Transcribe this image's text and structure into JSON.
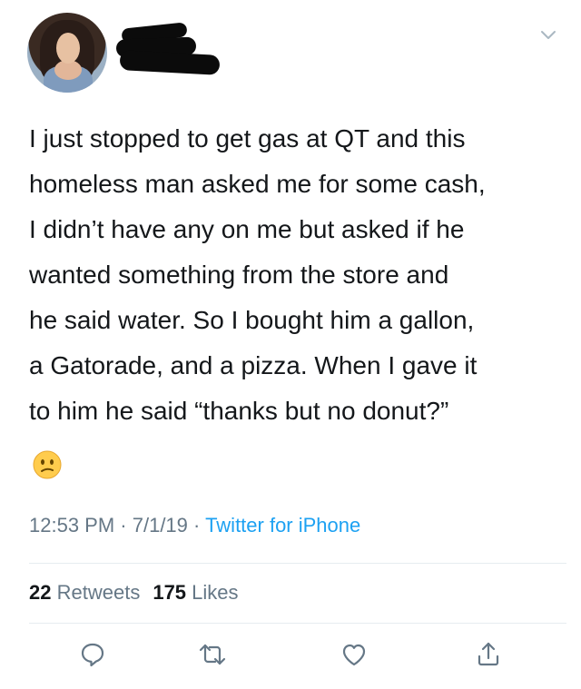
{
  "tweet": {
    "text": "I just stopped to get gas at QT and this\nhomeless man asked me for some cash,\nI didn’t have any on me but asked if he\nwanted something from the store and\nhe said water. So I bought him a gallon,\na Gatorade, and a pizza. When I gave it\nto him he said “thanks but no donut?”",
    "emoji": "confused-face",
    "time": "12:53 PM",
    "date": "7/1/19",
    "separator": " · ",
    "source": "Twitter for iPhone"
  },
  "stats": {
    "retweets_count": "22",
    "retweets_label": "Retweets",
    "likes_count": "175",
    "likes_label": "Likes"
  },
  "actions": [
    "reply-icon",
    "retweet-icon",
    "like-icon",
    "share-icon"
  ],
  "colors": {
    "text": "#14171a",
    "muted": "#657786",
    "link": "#1da1f2",
    "divider": "#e6ecf0"
  }
}
